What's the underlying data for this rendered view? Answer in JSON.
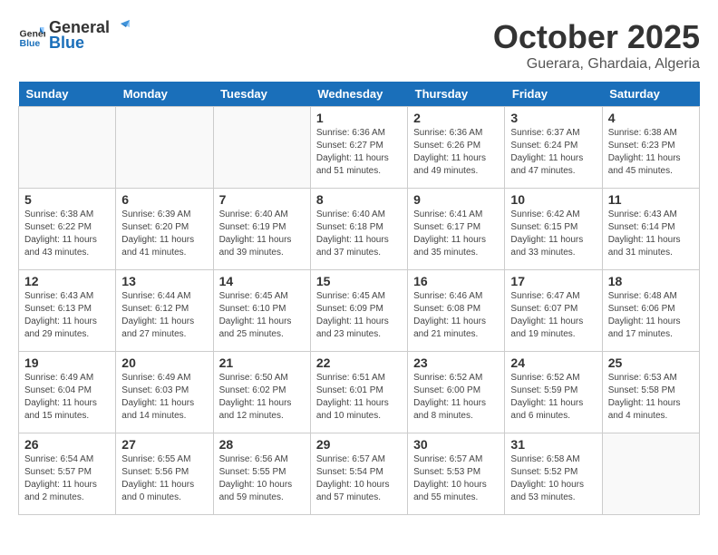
{
  "logo": {
    "line1": "General",
    "line2": "Blue"
  },
  "title": "October 2025",
  "location": "Guerara, Ghardaia, Algeria",
  "headers": [
    "Sunday",
    "Monday",
    "Tuesday",
    "Wednesday",
    "Thursday",
    "Friday",
    "Saturday"
  ],
  "weeks": [
    [
      {
        "day": "",
        "info": ""
      },
      {
        "day": "",
        "info": ""
      },
      {
        "day": "",
        "info": ""
      },
      {
        "day": "1",
        "info": "Sunrise: 6:36 AM\nSunset: 6:27 PM\nDaylight: 11 hours\nand 51 minutes."
      },
      {
        "day": "2",
        "info": "Sunrise: 6:36 AM\nSunset: 6:26 PM\nDaylight: 11 hours\nand 49 minutes."
      },
      {
        "day": "3",
        "info": "Sunrise: 6:37 AM\nSunset: 6:24 PM\nDaylight: 11 hours\nand 47 minutes."
      },
      {
        "day": "4",
        "info": "Sunrise: 6:38 AM\nSunset: 6:23 PM\nDaylight: 11 hours\nand 45 minutes."
      }
    ],
    [
      {
        "day": "5",
        "info": "Sunrise: 6:38 AM\nSunset: 6:22 PM\nDaylight: 11 hours\nand 43 minutes."
      },
      {
        "day": "6",
        "info": "Sunrise: 6:39 AM\nSunset: 6:20 PM\nDaylight: 11 hours\nand 41 minutes."
      },
      {
        "day": "7",
        "info": "Sunrise: 6:40 AM\nSunset: 6:19 PM\nDaylight: 11 hours\nand 39 minutes."
      },
      {
        "day": "8",
        "info": "Sunrise: 6:40 AM\nSunset: 6:18 PM\nDaylight: 11 hours\nand 37 minutes."
      },
      {
        "day": "9",
        "info": "Sunrise: 6:41 AM\nSunset: 6:17 PM\nDaylight: 11 hours\nand 35 minutes."
      },
      {
        "day": "10",
        "info": "Sunrise: 6:42 AM\nSunset: 6:15 PM\nDaylight: 11 hours\nand 33 minutes."
      },
      {
        "day": "11",
        "info": "Sunrise: 6:43 AM\nSunset: 6:14 PM\nDaylight: 11 hours\nand 31 minutes."
      }
    ],
    [
      {
        "day": "12",
        "info": "Sunrise: 6:43 AM\nSunset: 6:13 PM\nDaylight: 11 hours\nand 29 minutes."
      },
      {
        "day": "13",
        "info": "Sunrise: 6:44 AM\nSunset: 6:12 PM\nDaylight: 11 hours\nand 27 minutes."
      },
      {
        "day": "14",
        "info": "Sunrise: 6:45 AM\nSunset: 6:10 PM\nDaylight: 11 hours\nand 25 minutes."
      },
      {
        "day": "15",
        "info": "Sunrise: 6:45 AM\nSunset: 6:09 PM\nDaylight: 11 hours\nand 23 minutes."
      },
      {
        "day": "16",
        "info": "Sunrise: 6:46 AM\nSunset: 6:08 PM\nDaylight: 11 hours\nand 21 minutes."
      },
      {
        "day": "17",
        "info": "Sunrise: 6:47 AM\nSunset: 6:07 PM\nDaylight: 11 hours\nand 19 minutes."
      },
      {
        "day": "18",
        "info": "Sunrise: 6:48 AM\nSunset: 6:06 PM\nDaylight: 11 hours\nand 17 minutes."
      }
    ],
    [
      {
        "day": "19",
        "info": "Sunrise: 6:49 AM\nSunset: 6:04 PM\nDaylight: 11 hours\nand 15 minutes."
      },
      {
        "day": "20",
        "info": "Sunrise: 6:49 AM\nSunset: 6:03 PM\nDaylight: 11 hours\nand 14 minutes."
      },
      {
        "day": "21",
        "info": "Sunrise: 6:50 AM\nSunset: 6:02 PM\nDaylight: 11 hours\nand 12 minutes."
      },
      {
        "day": "22",
        "info": "Sunrise: 6:51 AM\nSunset: 6:01 PM\nDaylight: 11 hours\nand 10 minutes."
      },
      {
        "day": "23",
        "info": "Sunrise: 6:52 AM\nSunset: 6:00 PM\nDaylight: 11 hours\nand 8 minutes."
      },
      {
        "day": "24",
        "info": "Sunrise: 6:52 AM\nSunset: 5:59 PM\nDaylight: 11 hours\nand 6 minutes."
      },
      {
        "day": "25",
        "info": "Sunrise: 6:53 AM\nSunset: 5:58 PM\nDaylight: 11 hours\nand 4 minutes."
      }
    ],
    [
      {
        "day": "26",
        "info": "Sunrise: 6:54 AM\nSunset: 5:57 PM\nDaylight: 11 hours\nand 2 minutes."
      },
      {
        "day": "27",
        "info": "Sunrise: 6:55 AM\nSunset: 5:56 PM\nDaylight: 11 hours\nand 0 minutes."
      },
      {
        "day": "28",
        "info": "Sunrise: 6:56 AM\nSunset: 5:55 PM\nDaylight: 10 hours\nand 59 minutes."
      },
      {
        "day": "29",
        "info": "Sunrise: 6:57 AM\nSunset: 5:54 PM\nDaylight: 10 hours\nand 57 minutes."
      },
      {
        "day": "30",
        "info": "Sunrise: 6:57 AM\nSunset: 5:53 PM\nDaylight: 10 hours\nand 55 minutes."
      },
      {
        "day": "31",
        "info": "Sunrise: 6:58 AM\nSunset: 5:52 PM\nDaylight: 10 hours\nand 53 minutes."
      },
      {
        "day": "",
        "info": ""
      }
    ]
  ]
}
